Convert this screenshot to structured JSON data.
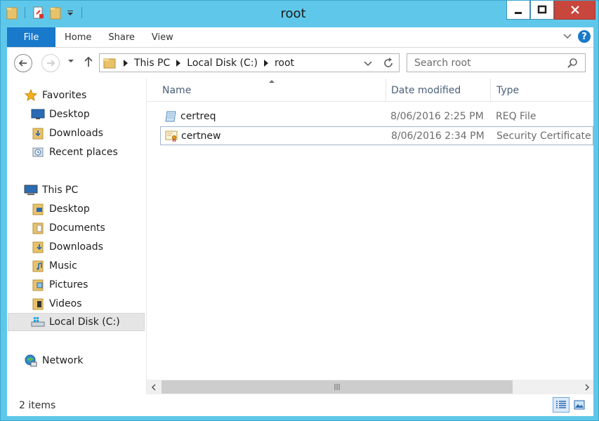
{
  "window": {
    "title": "root"
  },
  "ribbon": {
    "file_tab": "File",
    "tabs": [
      "Home",
      "Share",
      "View"
    ]
  },
  "address": {
    "crumbs": [
      "This PC",
      "Local Disk (C:)",
      "root"
    ]
  },
  "search": {
    "placeholder": "Search root"
  },
  "sidebar": {
    "favorites_label": "Favorites",
    "favorites": [
      "Desktop",
      "Downloads",
      "Recent places"
    ],
    "thispc_label": "This PC",
    "thispc": [
      "Desktop",
      "Documents",
      "Downloads",
      "Music",
      "Pictures",
      "Videos",
      "Local Disk (C:)"
    ],
    "network_label": "Network"
  },
  "columns": {
    "name": "Name",
    "date": "Date modified",
    "type": "Type"
  },
  "files": [
    {
      "name": "certreq",
      "date": "8/06/2016 2:25 PM",
      "type": "REQ File",
      "icon": "req-file-icon"
    },
    {
      "name": "certnew",
      "date": "8/06/2016 2:34 PM",
      "type": "Security Certificate",
      "icon": "certificate-icon"
    }
  ],
  "status": {
    "item_count": "2 items"
  },
  "colors": {
    "frame": "#5fc8ea",
    "file_tab": "#1979ca",
    "close": "#c9463d"
  }
}
